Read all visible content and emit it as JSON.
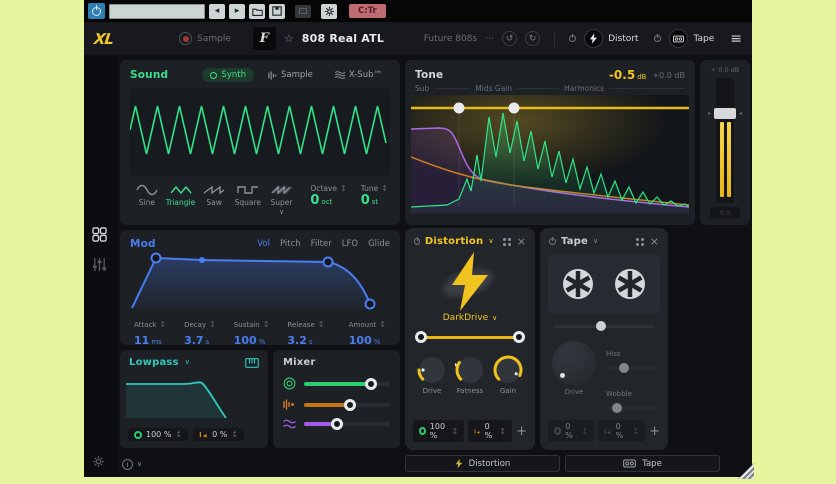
{
  "toolbar": {
    "badge": "C:Tr"
  },
  "header": {
    "logo": "XL",
    "sample_label": "Sample",
    "artwork_letter": "F",
    "preset_title": "808 Real ATL",
    "pack_label": "Future 808s",
    "chip_distort": "Distort",
    "chip_tape": "Tape"
  },
  "sound": {
    "title": "Sound",
    "mode_synth": "Synth",
    "mode_sample": "Sample",
    "mode_xsub": "X-Sub™",
    "wave_sine": "Sine",
    "wave_triangle": "Triangle",
    "wave_saw": "Saw",
    "wave_square": "Square",
    "wave_super": "Super",
    "octave_label": "Octave",
    "octave_value": "0",
    "octave_unit": "oct",
    "tune_label": "Tune",
    "tune_value": "0",
    "tune_unit": "st"
  },
  "tone": {
    "title": "Tone",
    "gain_value": "-0.5",
    "gain_unit": "dB",
    "alt_gain": "+0.0 dB",
    "band1": "Sub",
    "band2": "Mids Gain",
    "band3": "Harmonics"
  },
  "output": {
    "level_label": "+ 0.0 dB",
    "meter_readout": "0.0"
  },
  "mod": {
    "title": "Mod",
    "tab1": "Vol",
    "tab2": "Pitch",
    "tab3": "Filter",
    "tab4": "LFO",
    "tab5": "Glide",
    "p1l": "Attack",
    "p1v": "11",
    "p1u": "ms",
    "p2l": "Decay",
    "p2v": "3.7",
    "p2u": "s",
    "p3l": "Sustain",
    "p3v": "100",
    "p3u": "%",
    "p4l": "Release",
    "p4v": "3.2",
    "p4u": "s",
    "p5l": "Amount",
    "p5v": "100",
    "p5u": "%"
  },
  "lowpass": {
    "title": "Lowpass",
    "env_value": "100 %",
    "vel_value": "0 %"
  },
  "mixer": {
    "title": "Mixer"
  },
  "distortion": {
    "title": "Distortion",
    "algo": "DarkDrive",
    "knob1": "Drive",
    "knob2": "Fatness",
    "knob3": "Gain",
    "env_value": "100 %",
    "vel_value": "0 %",
    "add_label": "+"
  },
  "tape": {
    "title": "Tape",
    "knob_label": "Drive",
    "slider1": "Hiss",
    "slider2": "Wobble",
    "val1": "0 %",
    "val2": "0 %",
    "add_label": "+"
  },
  "bottom_bar": {
    "distortion_label": "Distortion",
    "tape_label": "Tape"
  }
}
